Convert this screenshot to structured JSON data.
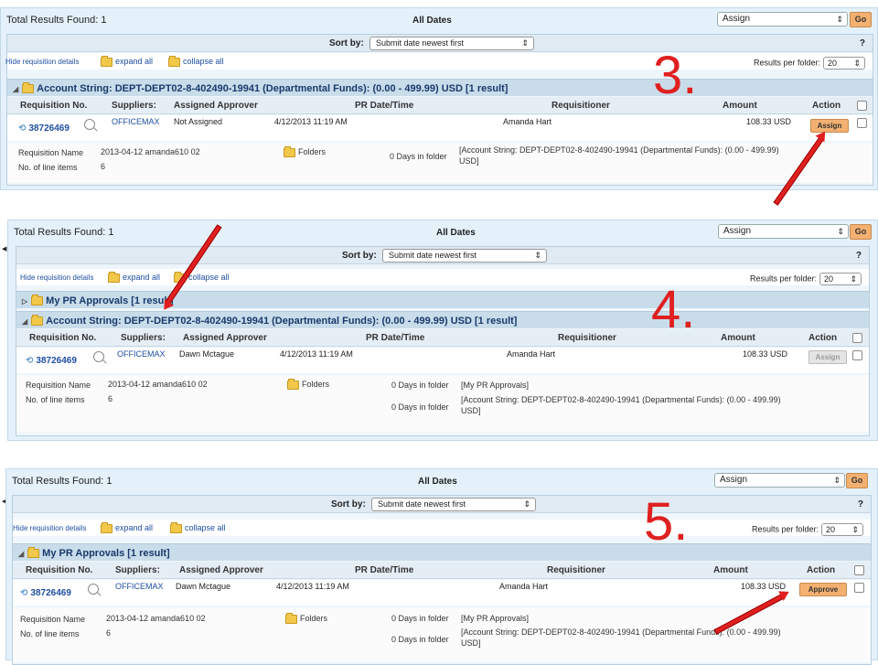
{
  "common": {
    "total_results": "Total Results Found: 1",
    "all_dates": "All Dates",
    "assign_select": "Assign",
    "go": "Go",
    "sort_by": "Sort by:",
    "sort_value": "Submit date newest first",
    "help": "?",
    "hide_details": "Hide requisition details",
    "expand_all": "expand all",
    "collapse_all": "collapse all",
    "results_per_folder": "Results per folder:",
    "results_per_folder_value": "20",
    "columns": {
      "req_no": "Requisition No.",
      "suppliers": "Suppliers:",
      "approver": "Assigned Approver",
      "date": "PR Date/Time",
      "requisitioner": "Requisitioner",
      "amount": "Amount",
      "action": "Action"
    },
    "req_number": "38726469",
    "supplier": "OFFICEMAX",
    "pr_date": "4/12/2013 11:19 AM",
    "requisitioner": "Amanda Hart",
    "amount": "108.33 USD",
    "req_name_label": "Requisition Name",
    "req_name_value": "2013-04-12 amanda610 02",
    "line_items_label": "No. of line items",
    "line_items_value": "6",
    "folders": "Folders",
    "days_in_folder": "0 Days in folder",
    "folder_pr": "[My PR Approvals]",
    "folder_account_1": "[Account String: DEPT-DEPT02-8-402490-19941 (Departmental Funds): (0.00 - 499.99)",
    "folder_account_2": "USD]"
  },
  "panel3": {
    "step": "3.",
    "group_title": "Account String: DEPT-DEPT02-8-402490-19941 (Departmental Funds): (0.00 - 499.99) USD [1 result]",
    "approver": "Not Assigned",
    "action": "Assign"
  },
  "panel4": {
    "step": "4.",
    "group1_title": "My PR Approvals [1 result]",
    "group2_title": "Account String: DEPT-DEPT02-8-402490-19941 (Departmental Funds): (0.00 - 499.99) USD [1 result]",
    "approver": "Dawn Mctague",
    "action": "Assign"
  },
  "panel5": {
    "step": "5.",
    "group_title": "My PR Approvals [1 result]",
    "approver": "Dawn Mctague",
    "action": "Approve"
  }
}
